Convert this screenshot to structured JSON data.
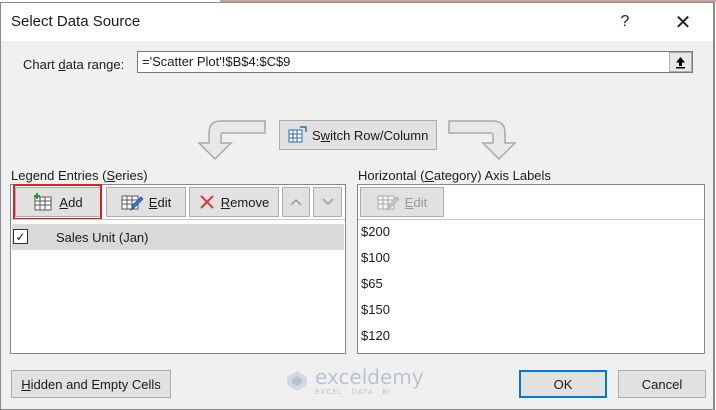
{
  "dialog": {
    "title": "Select Data Source",
    "help_label": "?",
    "close_label": "✕"
  },
  "range": {
    "label_pre": "Chart ",
    "label_u": "d",
    "label_post": "ata range:",
    "value": "='Scatter Plot'!$B$4:$C$9"
  },
  "switch": {
    "label_pre": "S",
    "label_u": "w",
    "label_post": "itch Row/Column"
  },
  "legend": {
    "heading_pre": "Legend Entries (",
    "heading_u": "S",
    "heading_post": "eries)",
    "add_u": "A",
    "add_post": "dd",
    "edit_u": "E",
    "edit_post": "dit",
    "remove_u": "R",
    "remove_post": "emove",
    "series": [
      {
        "name": "Sales Unit (Jan)",
        "checked": true
      }
    ]
  },
  "category": {
    "heading_pre": "Horizontal (",
    "heading_u": "C",
    "heading_post": "ategory) Axis Labels",
    "edit_u": "E",
    "edit_post": "dit",
    "items": [
      "$200",
      "$100",
      "$65",
      "$150",
      "$120"
    ]
  },
  "footer": {
    "hidden_u": "H",
    "hidden_post": "idden and Empty Cells",
    "ok_label": "OK",
    "cancel_label": "Cancel"
  },
  "watermark": {
    "name": "exceldemy",
    "sub": "EXCEL · DATA · BI"
  },
  "colors": {
    "highlight": "#e02020",
    "accent": "#0078d7"
  }
}
